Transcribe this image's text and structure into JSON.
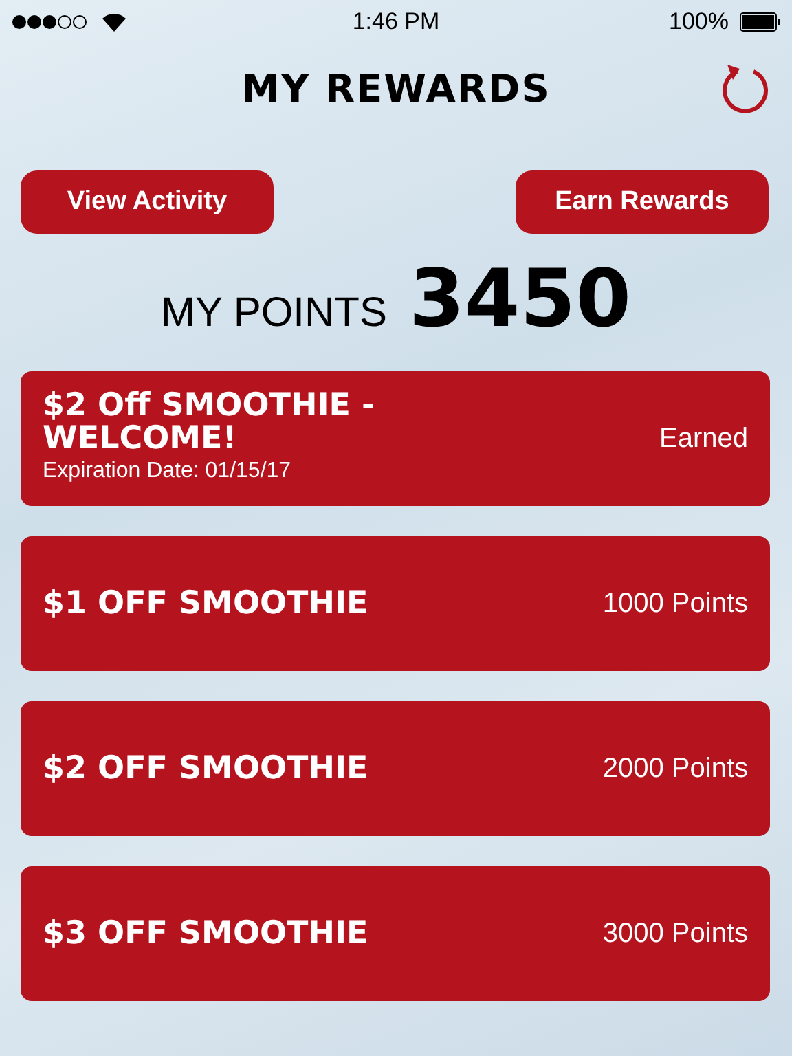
{
  "status_bar": {
    "time": "1:46 PM",
    "battery": "100%"
  },
  "header": {
    "title": "MY REWARDS"
  },
  "buttons": [
    {
      "label": "View Activity"
    },
    {
      "label": "Earn Rewards"
    }
  ],
  "points": {
    "label": "MY POINTS",
    "value": "3450"
  },
  "rewards": [
    {
      "title": "$2 Off SMOOTHIE - WELCOME!",
      "expiration": "Expiration Date: 01/15/17",
      "status": "Earned"
    },
    {
      "title": "$1 OFF SMOOTHIE",
      "status": "1000 Points"
    },
    {
      "title": "$2 OFF SMOOTHIE",
      "status": "2000 Points"
    },
    {
      "title": "$3 OFF SMOOTHIE",
      "status": "3000 Points"
    }
  ]
}
